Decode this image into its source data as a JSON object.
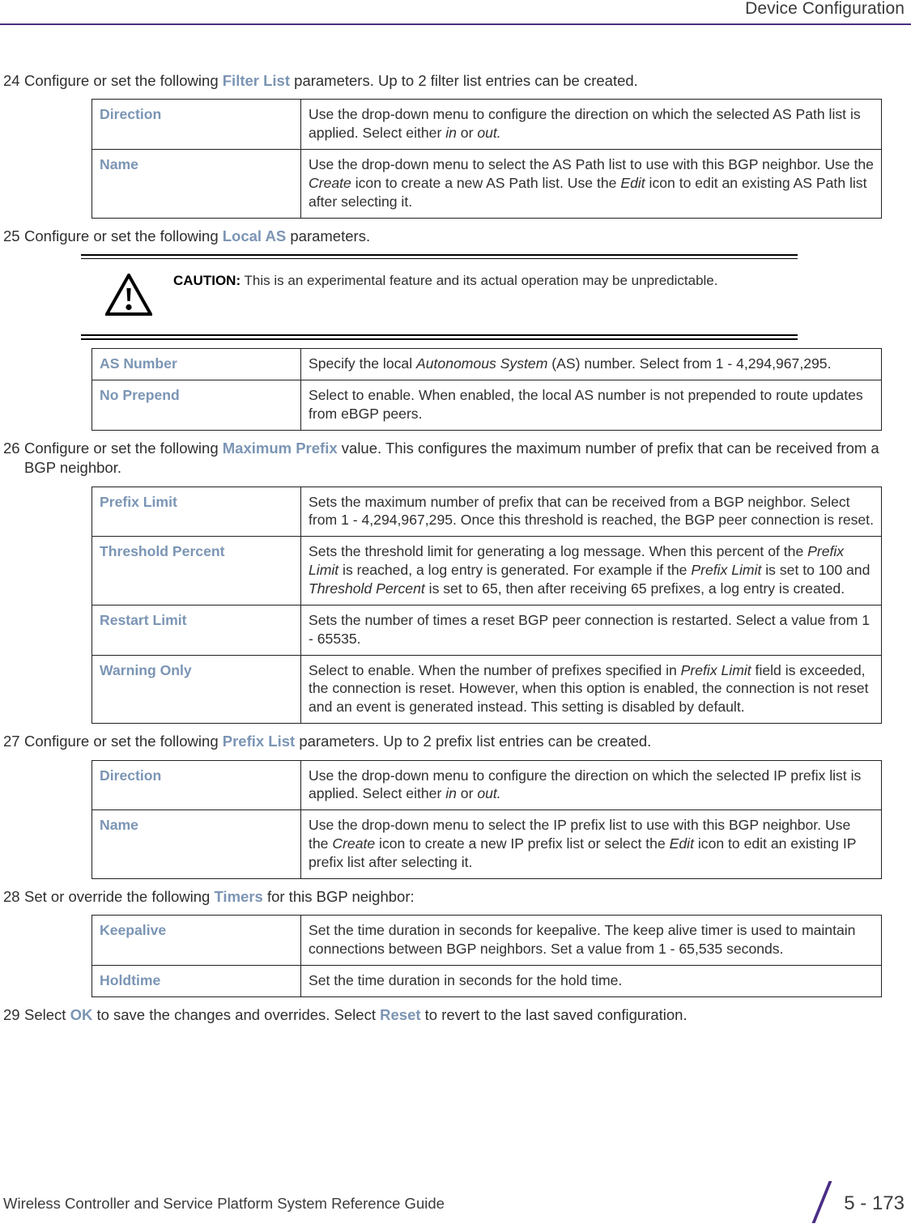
{
  "header": {
    "title": "Device Configuration",
    "rule_color": "#4b2d86"
  },
  "theme": {
    "keyword_color": "#7b95b4",
    "text_color": "#2f2f31",
    "accent_color": "#4b2d86"
  },
  "steps": [
    {
      "number": "24",
      "text_before": "Configure or set the following ",
      "keyword": "Filter List",
      "text_after": " parameters. Up to 2 filter list entries can be created."
    },
    {
      "number": "25",
      "text_before": "Configure or set the following ",
      "keyword": "Local AS",
      "text_after": " parameters."
    },
    {
      "number": "26",
      "text_before": "Configure or set the following ",
      "keyword": "Maximum Prefix",
      "text_after": " value. This configures the maximum number of prefix that can be received from a BGP neighbor."
    },
    {
      "number": "27",
      "text_before": "Configure or set the following ",
      "keyword": "Prefix List",
      "text_after": " parameters. Up to 2 prefix list entries can be created."
    },
    {
      "number": "28",
      "text_before": "Set or override the following ",
      "keyword": "Timers",
      "text_after": " for this BGP neighbor:"
    }
  ],
  "final_step": {
    "number": "29",
    "part1": "Select ",
    "kw1": "OK",
    "part2": " to save the changes and overrides. Select ",
    "kw2": "Reset",
    "part3": " to revert to the last saved configuration."
  },
  "caution": {
    "icon": "warning-triangle-icon",
    "label": "CAUTION:",
    "text": " This is an experimental feature and its actual operation may be unpredictable."
  },
  "tables": {
    "filter_list": [
      {
        "term": "Direction",
        "desc_parts": [
          {
            "t": "Use the drop-down menu to configure the direction on which the selected AS Path list is applied. Select either ",
            "i": false
          },
          {
            "t": "in",
            "i": true
          },
          {
            "t": " or ",
            "i": false
          },
          {
            "t": "out.",
            "i": true
          }
        ]
      },
      {
        "term": "Name",
        "desc_parts": [
          {
            "t": "Use the drop-down menu to select the AS Path list to use with this BGP neighbor. Use the ",
            "i": false
          },
          {
            "t": "Create",
            "i": true
          },
          {
            "t": " icon to create a new AS Path list. Use the ",
            "i": false
          },
          {
            "t": "Edit",
            "i": true
          },
          {
            "t": " icon to edit an existing AS Path list after selecting it.",
            "i": false
          }
        ]
      }
    ],
    "local_as": [
      {
        "term": "AS Number",
        "desc_parts": [
          {
            "t": "Specify the local ",
            "i": false
          },
          {
            "t": "Autonomous System",
            "i": true
          },
          {
            "t": " (AS) number. Select from 1 - 4,294,967,295.",
            "i": false
          }
        ]
      },
      {
        "term": "No Prepend",
        "desc_parts": [
          {
            "t": "Select to enable. When enabled, the local AS number is not prepended to route updates from eBGP peers.",
            "i": false
          }
        ]
      }
    ],
    "maximum_prefix": [
      {
        "term": "Prefix Limit",
        "desc_parts": [
          {
            "t": "Sets the maximum number of prefix that can be received from a BGP neighbor. Select from 1 - 4,294,967,295. Once this threshold is reached, the BGP peer connection is reset.",
            "i": false
          }
        ]
      },
      {
        "term": "Threshold Percent",
        "desc_parts": [
          {
            "t": "Sets the threshold limit for generating a log message. When this percent of the ",
            "i": false
          },
          {
            "t": "Prefix Limit",
            "i": true
          },
          {
            "t": " is reached, a log entry is generated. For example if the ",
            "i": false
          },
          {
            "t": "Prefix Limit",
            "i": true
          },
          {
            "t": " is set to 100 and ",
            "i": false
          },
          {
            "t": "Threshold Percent",
            "i": true
          },
          {
            "t": " is set to 65, then after receiving 65 prefixes, a log entry is created.",
            "i": false
          }
        ]
      },
      {
        "term": "Restart Limit",
        "desc_parts": [
          {
            "t": "Sets the number of times a reset BGP peer connection is restarted. Select a value from 1 - 65535.",
            "i": false
          }
        ]
      },
      {
        "term": "Warning Only",
        "desc_parts": [
          {
            "t": "Select to enable. When the number of prefixes specified in ",
            "i": false
          },
          {
            "t": "Prefix Limit",
            "i": true
          },
          {
            "t": " field is exceeded, the connection is reset. However, when this option is enabled, the connection is not reset and an event is generated instead. This setting is disabled by default.",
            "i": false
          }
        ]
      }
    ],
    "prefix_list": [
      {
        "term": "Direction",
        "desc_parts": [
          {
            "t": "Use the drop-down menu to configure the direction on which the selected IP prefix list is applied. Select either ",
            "i": false
          },
          {
            "t": "in",
            "i": true
          },
          {
            "t": " or ",
            "i": false
          },
          {
            "t": "out.",
            "i": true
          }
        ]
      },
      {
        "term": "Name",
        "desc_parts": [
          {
            "t": "Use the drop-down menu to select the IP prefix list to use with this BGP neighbor. Use the ",
            "i": false
          },
          {
            "t": "Create",
            "i": true
          },
          {
            "t": " icon to create a new IP prefix list or select the ",
            "i": false
          },
          {
            "t": "Edit",
            "i": true
          },
          {
            "t": " icon to edit an existing IP prefix list after selecting it.",
            "i": false
          }
        ]
      }
    ],
    "timers": [
      {
        "term": "Keepalive",
        "desc_parts": [
          {
            "t": "Set the time duration in seconds for keepalive. The keep alive timer is used to maintain connections between BGP neighbors. Set a value from 1 - 65,535 seconds.",
            "i": false
          }
        ]
      },
      {
        "term": "Holdtime",
        "desc_parts": [
          {
            "t": "Set the time duration in seconds for the hold time.",
            "i": false
          }
        ]
      }
    ]
  },
  "footer": {
    "guide": "Wireless Controller and Service Platform System Reference Guide",
    "page": "5 - 173"
  }
}
